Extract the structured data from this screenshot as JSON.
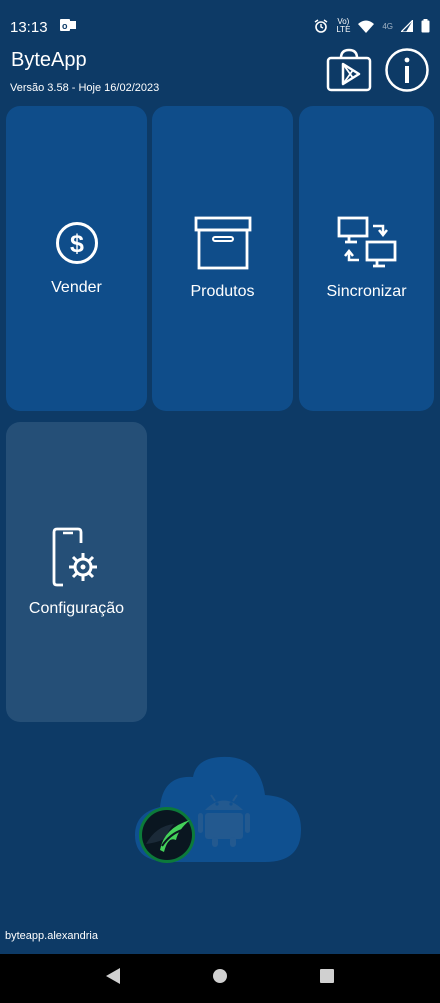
{
  "status_bar": {
    "time": "13:13",
    "network_label_top": "Vo) LTE",
    "network_4g": "4G"
  },
  "header": {
    "title": "ByteApp",
    "version": "Versão 3.58 - Hoje 16/02/2023"
  },
  "tiles": [
    {
      "label": "Vender",
      "icon": "dollar-icon"
    },
    {
      "label": "Produtos",
      "icon": "box-icon"
    },
    {
      "label": "Sincronizar",
      "icon": "sync-icon"
    },
    {
      "label": "Configuração",
      "icon": "phone-settings-icon"
    }
  ],
  "footer": {
    "package": "byteapp.alexandria"
  },
  "colors": {
    "background": "#0d3a66",
    "tile": "#0f4d8a",
    "tile_config": "#254f77",
    "nav_bar": "#000000"
  }
}
